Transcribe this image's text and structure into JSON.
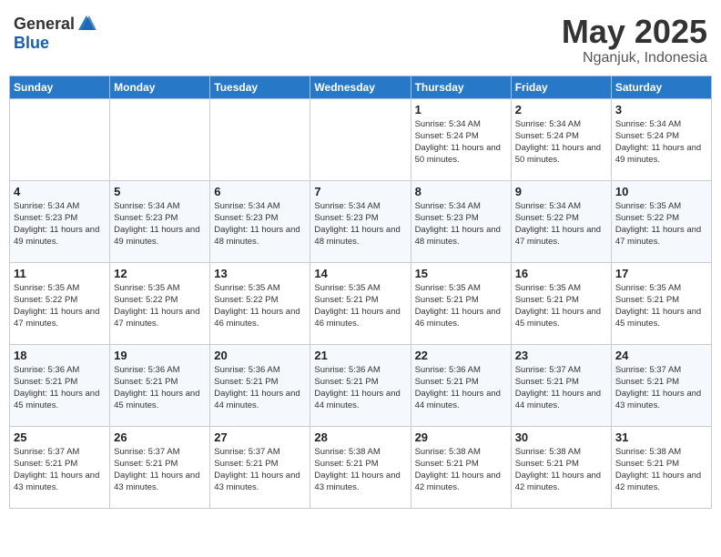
{
  "logo": {
    "general": "General",
    "blue": "Blue"
  },
  "title": {
    "month": "May 2025",
    "location": "Nganjuk, Indonesia"
  },
  "weekdays": [
    "Sunday",
    "Monday",
    "Tuesday",
    "Wednesday",
    "Thursday",
    "Friday",
    "Saturday"
  ],
  "weeks": [
    [
      {
        "day": "",
        "info": ""
      },
      {
        "day": "",
        "info": ""
      },
      {
        "day": "",
        "info": ""
      },
      {
        "day": "",
        "info": ""
      },
      {
        "day": "1",
        "info": "Sunrise: 5:34 AM\nSunset: 5:24 PM\nDaylight: 11 hours\nand 50 minutes."
      },
      {
        "day": "2",
        "info": "Sunrise: 5:34 AM\nSunset: 5:24 PM\nDaylight: 11 hours\nand 50 minutes."
      },
      {
        "day": "3",
        "info": "Sunrise: 5:34 AM\nSunset: 5:24 PM\nDaylight: 11 hours\nand 49 minutes."
      }
    ],
    [
      {
        "day": "4",
        "info": "Sunrise: 5:34 AM\nSunset: 5:23 PM\nDaylight: 11 hours\nand 49 minutes."
      },
      {
        "day": "5",
        "info": "Sunrise: 5:34 AM\nSunset: 5:23 PM\nDaylight: 11 hours\nand 49 minutes."
      },
      {
        "day": "6",
        "info": "Sunrise: 5:34 AM\nSunset: 5:23 PM\nDaylight: 11 hours\nand 48 minutes."
      },
      {
        "day": "7",
        "info": "Sunrise: 5:34 AM\nSunset: 5:23 PM\nDaylight: 11 hours\nand 48 minutes."
      },
      {
        "day": "8",
        "info": "Sunrise: 5:34 AM\nSunset: 5:23 PM\nDaylight: 11 hours\nand 48 minutes."
      },
      {
        "day": "9",
        "info": "Sunrise: 5:34 AM\nSunset: 5:22 PM\nDaylight: 11 hours\nand 47 minutes."
      },
      {
        "day": "10",
        "info": "Sunrise: 5:35 AM\nSunset: 5:22 PM\nDaylight: 11 hours\nand 47 minutes."
      }
    ],
    [
      {
        "day": "11",
        "info": "Sunrise: 5:35 AM\nSunset: 5:22 PM\nDaylight: 11 hours\nand 47 minutes."
      },
      {
        "day": "12",
        "info": "Sunrise: 5:35 AM\nSunset: 5:22 PM\nDaylight: 11 hours\nand 47 minutes."
      },
      {
        "day": "13",
        "info": "Sunrise: 5:35 AM\nSunset: 5:22 PM\nDaylight: 11 hours\nand 46 minutes."
      },
      {
        "day": "14",
        "info": "Sunrise: 5:35 AM\nSunset: 5:21 PM\nDaylight: 11 hours\nand 46 minutes."
      },
      {
        "day": "15",
        "info": "Sunrise: 5:35 AM\nSunset: 5:21 PM\nDaylight: 11 hours\nand 46 minutes."
      },
      {
        "day": "16",
        "info": "Sunrise: 5:35 AM\nSunset: 5:21 PM\nDaylight: 11 hours\nand 45 minutes."
      },
      {
        "day": "17",
        "info": "Sunrise: 5:35 AM\nSunset: 5:21 PM\nDaylight: 11 hours\nand 45 minutes."
      }
    ],
    [
      {
        "day": "18",
        "info": "Sunrise: 5:36 AM\nSunset: 5:21 PM\nDaylight: 11 hours\nand 45 minutes."
      },
      {
        "day": "19",
        "info": "Sunrise: 5:36 AM\nSunset: 5:21 PM\nDaylight: 11 hours\nand 45 minutes."
      },
      {
        "day": "20",
        "info": "Sunrise: 5:36 AM\nSunset: 5:21 PM\nDaylight: 11 hours\nand 44 minutes."
      },
      {
        "day": "21",
        "info": "Sunrise: 5:36 AM\nSunset: 5:21 PM\nDaylight: 11 hours\nand 44 minutes."
      },
      {
        "day": "22",
        "info": "Sunrise: 5:36 AM\nSunset: 5:21 PM\nDaylight: 11 hours\nand 44 minutes."
      },
      {
        "day": "23",
        "info": "Sunrise: 5:37 AM\nSunset: 5:21 PM\nDaylight: 11 hours\nand 44 minutes."
      },
      {
        "day": "24",
        "info": "Sunrise: 5:37 AM\nSunset: 5:21 PM\nDaylight: 11 hours\nand 43 minutes."
      }
    ],
    [
      {
        "day": "25",
        "info": "Sunrise: 5:37 AM\nSunset: 5:21 PM\nDaylight: 11 hours\nand 43 minutes."
      },
      {
        "day": "26",
        "info": "Sunrise: 5:37 AM\nSunset: 5:21 PM\nDaylight: 11 hours\nand 43 minutes."
      },
      {
        "day": "27",
        "info": "Sunrise: 5:37 AM\nSunset: 5:21 PM\nDaylight: 11 hours\nand 43 minutes."
      },
      {
        "day": "28",
        "info": "Sunrise: 5:38 AM\nSunset: 5:21 PM\nDaylight: 11 hours\nand 43 minutes."
      },
      {
        "day": "29",
        "info": "Sunrise: 5:38 AM\nSunset: 5:21 PM\nDaylight: 11 hours\nand 42 minutes."
      },
      {
        "day": "30",
        "info": "Sunrise: 5:38 AM\nSunset: 5:21 PM\nDaylight: 11 hours\nand 42 minutes."
      },
      {
        "day": "31",
        "info": "Sunrise: 5:38 AM\nSunset: 5:21 PM\nDaylight: 11 hours\nand 42 minutes."
      }
    ]
  ]
}
